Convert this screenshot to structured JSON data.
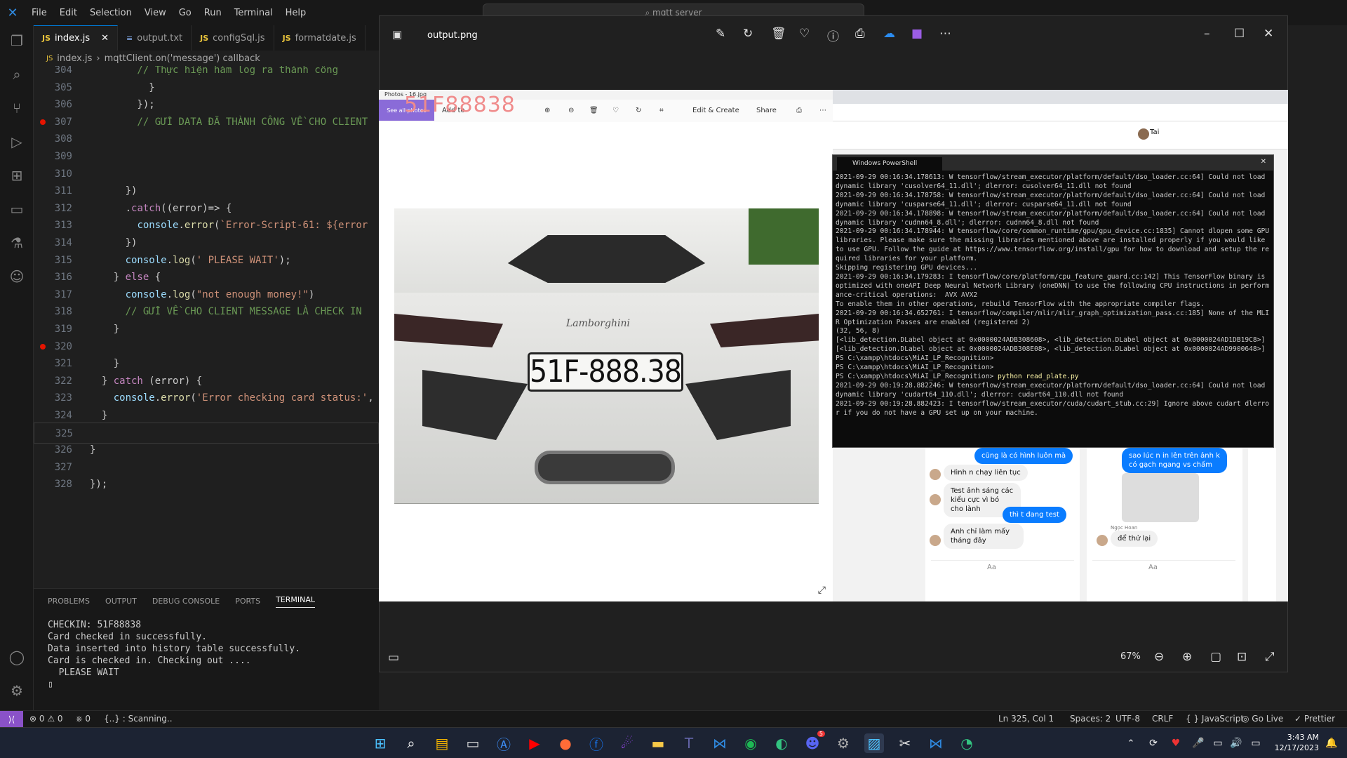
{
  "vscode": {
    "menu": [
      "File",
      "Edit",
      "Selection",
      "View",
      "Go",
      "Run",
      "Terminal",
      "Help"
    ],
    "search_placeholder": "mqtt server",
    "tabs": [
      {
        "label": "index.js",
        "type": "JS"
      },
      {
        "label": "output.txt",
        "type": "TXT"
      },
      {
        "label": "configSql.js",
        "type": "JS"
      },
      {
        "label": "formatdate.js",
        "type": "JS"
      }
    ],
    "breadcrumb": {
      "file": "index.js",
      "symbol": "mqttClient.on('message') callback"
    },
    "code_lines": [
      {
        "n": "304",
        "t": "        // Thực hiện hàm log ra thành công"
      },
      {
        "n": "305",
        "t": "          }"
      },
      {
        "n": "306",
        "t": "        });"
      },
      {
        "n": "307",
        "t": "        // GỬI DATA ĐÃ THÀNH CÔNG VỀ CHO CLIENT",
        "bp": true
      },
      {
        "n": "308",
        "t": ""
      },
      {
        "n": "309",
        "t": ""
      },
      {
        "n": "310",
        "t": ""
      },
      {
        "n": "311",
        "t": "      })"
      },
      {
        "n": "312",
        "t": "      .catch((error)=> {"
      },
      {
        "n": "313",
        "t": "        console.error(`Error-Script-61: ${error"
      },
      {
        "n": "314",
        "t": "      })"
      },
      {
        "n": "315",
        "t": "      console.log(' PLEASE WAIT');"
      },
      {
        "n": "316",
        "t": "    } else {"
      },
      {
        "n": "317",
        "t": "      console.log(\"not enough money!\")"
      },
      {
        "n": "318",
        "t": "      // GỬI VỀ CHO CLIENT MESSAGE LÀ CHECK IN"
      },
      {
        "n": "319",
        "t": "    }"
      },
      {
        "n": "320",
        "t": "",
        "bp": true
      },
      {
        "n": "321",
        "t": "    }"
      },
      {
        "n": "322",
        "t": "  } catch (error) {"
      },
      {
        "n": "323",
        "t": "    console.error('Error checking card status:',"
      },
      {
        "n": "324",
        "t": "  }"
      },
      {
        "n": "325",
        "t": ""
      },
      {
        "n": "326",
        "t": "}"
      },
      {
        "n": "327",
        "t": ""
      },
      {
        "n": "328",
        "t": "});"
      }
    ],
    "panel_tabs": [
      "PROBLEMS",
      "OUTPUT",
      "DEBUG CONSOLE",
      "PORTS",
      "TERMINAL"
    ],
    "terminal_lines": [
      "CHECKIN: 51F88838",
      "Card checked in successfully.",
      "Data inserted into history table successfully.",
      "Card is checked in. Checking out ....",
      "  PLEASE WAIT"
    ],
    "status": {
      "errors": "0",
      "warnings": "0",
      "ports": "0",
      "scanning": "{..} : Scanning..",
      "position": "Ln 325, Col 1",
      "spaces": "Spaces: 2",
      "encoding": "UTF-8",
      "eol": "CRLF",
      "language": "JavaScript",
      "golive": "Go Live",
      "prettier": "Prettier"
    }
  },
  "photos": {
    "filename": "output.png",
    "zoom": "67%",
    "inner_title": "Photos - 16.jpg",
    "see_all": "See all photos",
    "add_to": "Add to",
    "edit_create": "Edit & Create",
    "share": "Share",
    "overlay_plate": "51F88838",
    "car_brand": "Lamborghini",
    "plate_text": "51F-888.38"
  },
  "powershell": {
    "title": "Windows PowerShell",
    "lines": [
      "2021-09-29 00:16:34.178613: W tensorflow/stream_executor/platform/default/dso_loader.cc:64] Could not load dynamic library 'cusolver64_11.dll'; dlerror: cusolver64_11.dll not found",
      "2021-09-29 00:16:34.178758: W tensorflow/stream_executor/platform/default/dso_loader.cc:64] Could not load dynamic library 'cusparse64_11.dll'; dlerror: cusparse64_11.dll not found",
      "2021-09-29 00:16:34.178898: W tensorflow/stream_executor/platform/default/dso_loader.cc:64] Could not load dynamic library 'cudnn64_8.dll'; dlerror: cudnn64_8.dll not found",
      "2021-09-29 00:16:34.178944: W tensorflow/core/common_runtime/gpu/gpu_device.cc:1835] Cannot dlopen some GPU libraries. Please make sure the missing libraries mentioned above are installed properly if you would like to use GPU. Follow the guide at https://www.tensorflow.org/install/gpu for how to download and setup the required libraries for your platform.",
      "Skipping registering GPU devices...",
      "2021-09-29 00:16:34.179283: I tensorflow/core/platform/cpu_feature_guard.cc:142] This TensorFlow binary is optimized with oneAPI Deep Neural Network Library (oneDNN) to use the following CPU instructions in performance-critical operations:  AVX AVX2",
      "To enable them in other operations, rebuild TensorFlow with the appropriate compiler flags.",
      "2021-09-29 00:16:34.652761: I tensorflow/compiler/mlir/mlir_graph_optimization_pass.cc:185] None of the MLIR Optimization Passes are enabled (registered 2)",
      "(32, 56, 8)",
      "[<lib_detection.DLabel object at 0x0000024ADB308608>, <lib_detection.DLabel object at 0x0000024AD1DB19C8>]",
      "[<lib_detection.DLabel object at 0x0000024ADB308E08>, <lib_detection.DLabel object at 0x0000024AD9900648>]",
      "PS C:\\xampp\\htdocs\\MiAI_LP_Recognition>",
      "PS C:\\xampp\\htdocs\\MiAI_LP_Recognition>",
      "PS C:\\xampp\\htdocs\\MiAI_LP_Recognition> python read_plate.py",
      "2021-09-29 00:19:28.882246: W tensorflow/stream_executor/platform/default/dso_loader.cc:64] Could not load dynamic library 'cudart64_110.dll'; dlerror: cudart64_110.dll not found",
      "2021-09-29 00:19:28.882423: I tensorflow/stream_executor/cuda/cudart_stub.cc:29] Ignore above cudart dlerror if you do not have a GPU set up on your machine."
    ]
  },
  "chat": {
    "left": [
      "cũng là có hình luôn mà",
      "Hình n chạy liên tục",
      "Test ảnh sáng các kiểu cực vì bó cho lành",
      "thì t đang test",
      "Anh chỉ làm mấy tháng đây"
    ],
    "right": [
      "sao lúc n in lên trên ảnh k có gạch ngang vs chấm",
      "Ngọc Hoan",
      "để thử lại"
    ],
    "input_placeholder": "Aa",
    "user": "Tai"
  },
  "taskbar": {
    "time": "3:43 AM",
    "date": "12/17/2023",
    "badge_discord": "5"
  }
}
